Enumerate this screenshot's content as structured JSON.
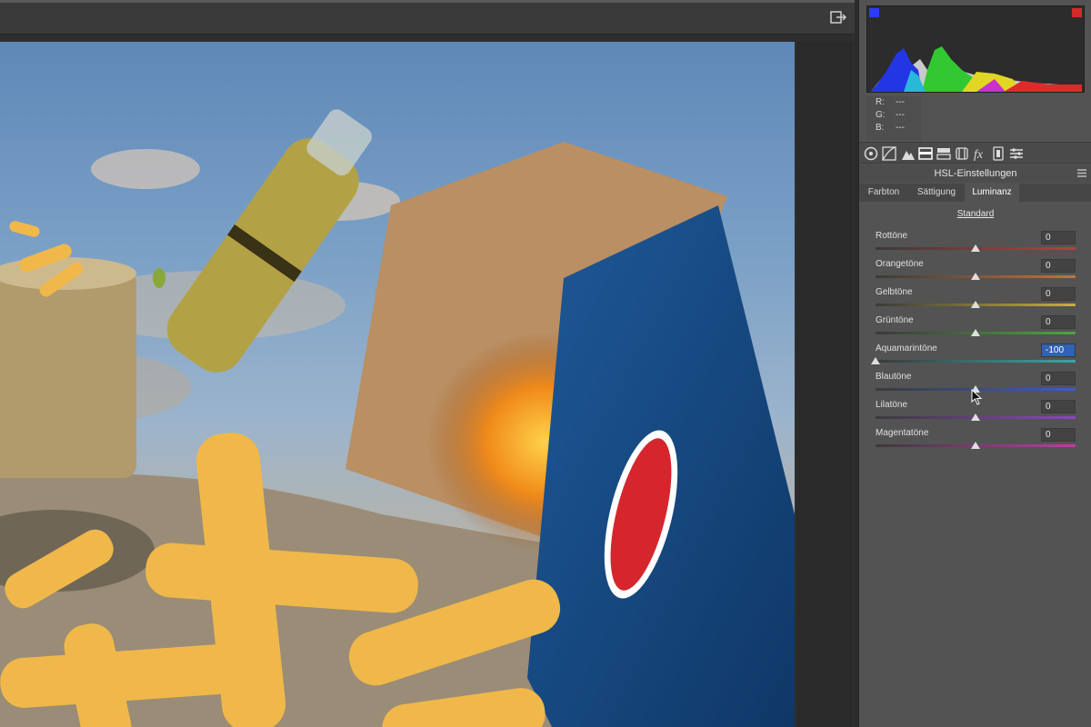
{
  "histogram": {
    "readout": [
      {
        "label": "R:",
        "value": "---"
      },
      {
        "label": "G:",
        "value": "---"
      },
      {
        "label": "B:",
        "value": "---"
      }
    ]
  },
  "panel_tools": [
    "basic-icon",
    "tone-curve-icon",
    "detail-icon",
    "hsl-icon",
    "split-toning-icon",
    "lens-icon",
    "fx-icon",
    "calibration-icon",
    "presets-icon"
  ],
  "section": {
    "title": "HSL-Einstellungen"
  },
  "tabs": [
    {
      "label": "Farbton",
      "active": false
    },
    {
      "label": "Sättigung",
      "active": false
    },
    {
      "label": "Luminanz",
      "active": true
    }
  ],
  "standard_label": "Standard",
  "sliders": [
    {
      "label": "Rottöne",
      "value": "0",
      "position": 0.5,
      "selected": false,
      "gradient": [
        "#3a3a3a",
        "#b84040"
      ]
    },
    {
      "label": "Orangetöne",
      "value": "0",
      "position": 0.5,
      "selected": false,
      "gradient": [
        "#3a3a3a",
        "#c4733a"
      ]
    },
    {
      "label": "Gelbtöne",
      "value": "0",
      "position": 0.5,
      "selected": false,
      "gradient": [
        "#3a3a3a",
        "#c8b13a"
      ]
    },
    {
      "label": "Grüntöne",
      "value": "0",
      "position": 0.5,
      "selected": false,
      "gradient": [
        "#3a3a3a",
        "#4ea640"
      ]
    },
    {
      "label": "Aquamarintöne",
      "value": "-100",
      "position": 0.0,
      "selected": true,
      "gradient": [
        "#3a3a3a",
        "#3aa6a6"
      ]
    },
    {
      "label": "Blautöne",
      "value": "0",
      "position": 0.5,
      "selected": false,
      "gradient": [
        "#3a3a3a",
        "#3a5fc4"
      ]
    },
    {
      "label": "Lilatöne",
      "value": "0",
      "position": 0.5,
      "selected": false,
      "gradient": [
        "#3a3a3a",
        "#8a46c0"
      ]
    },
    {
      "label": "Magentatöne",
      "value": "0",
      "position": 0.5,
      "selected": false,
      "gradient": [
        "#3a3a3a",
        "#c03aa6"
      ]
    }
  ],
  "colors": {
    "accent_selected": "#2f62b8",
    "panel_bg": "#535353"
  }
}
